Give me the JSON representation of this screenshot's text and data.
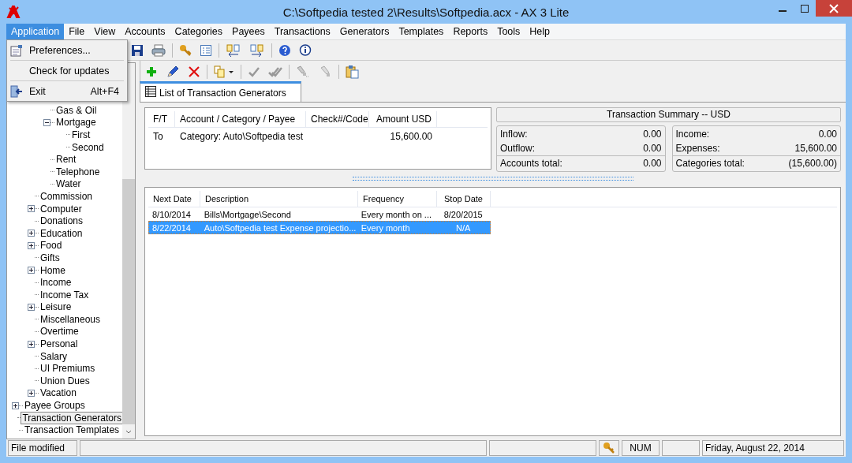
{
  "window": {
    "title": "C:\\Softpedia tested 2\\Results\\Softpedia.acx - AX 3 Lite"
  },
  "menubar": [
    {
      "label": "Application",
      "selected": true
    },
    {
      "label": "File",
      "selected": false
    },
    {
      "label": "View",
      "selected": false
    },
    {
      "label": "Accounts",
      "selected": false
    },
    {
      "label": "Categories",
      "selected": false
    },
    {
      "label": "Payees",
      "selected": false
    },
    {
      "label": "Transactions",
      "selected": false
    },
    {
      "label": "Generators",
      "selected": false
    },
    {
      "label": "Templates",
      "selected": false
    },
    {
      "label": "Reports",
      "selected": false
    },
    {
      "label": "Tools",
      "selected": false
    },
    {
      "label": "Help",
      "selected": false
    }
  ],
  "app_menu": [
    {
      "label": "Preferences...",
      "kind": "prefs"
    },
    {
      "label": "Check for updates",
      "kind": "plain"
    },
    {
      "label": "Exit",
      "kind": "exit",
      "shortcut": "Alt+F4"
    }
  ],
  "tree": [
    {
      "children": [
        {
          "children": [
            {
              "label": "Gas & Oil",
              "selected": false
            },
            {
              "label": "Mortgage",
              "expanded": true,
              "selected": false,
              "children": [
                {
                  "label": "First",
                  "selected": false
                },
                {
                  "label": "Second",
                  "selected": false
                }
              ]
            },
            {
              "label": "Rent",
              "selected": false
            },
            {
              "label": "Telephone",
              "selected": false
            },
            {
              "label": "Water",
              "selected": false
            }
          ]
        },
        {
          "label": "Commission",
          "selected": false
        },
        {
          "label": "Computer",
          "expanded": false,
          "selected": false
        },
        {
          "label": "Donations",
          "selected": false
        },
        {
          "label": "Education",
          "expanded": false,
          "selected": false
        },
        {
          "label": "Food",
          "expanded": false,
          "selected": false
        },
        {
          "label": "Gifts",
          "selected": false
        },
        {
          "label": "Home",
          "expanded": false,
          "selected": false
        },
        {
          "label": "Income",
          "selected": false
        },
        {
          "label": "Income Tax",
          "selected": false
        },
        {
          "label": "Leisure",
          "expanded": false,
          "selected": false
        },
        {
          "label": "Miscellaneous",
          "selected": false
        },
        {
          "label": "Overtime",
          "selected": false
        },
        {
          "label": "Personal",
          "expanded": false,
          "selected": false
        },
        {
          "label": "Salary",
          "selected": false
        },
        {
          "label": "UI Premiums",
          "selected": false
        },
        {
          "label": "Union Dues",
          "selected": false
        },
        {
          "label": "Vacation",
          "expanded": false,
          "selected": false
        }
      ]
    },
    {
      "label": "Payee Groups",
      "expanded": false,
      "selected": false
    },
    {
      "label": "Transaction Generators",
      "selected": true
    },
    {
      "label": "Transaction Templates",
      "selected": false
    }
  ],
  "tab": {
    "label": "List of Transaction Generators"
  },
  "splits": {
    "columns": [
      "F/T",
      "Account / Category / Payee",
      "Check#/Code",
      "Amount USD"
    ],
    "rows": [
      [
        "To",
        "Category: Auto\\Softpedia test",
        "",
        "15,600.00"
      ]
    ]
  },
  "summary": {
    "title": "Transaction Summary -- USD",
    "accounts": [
      {
        "label": "Inflow:",
        "value": "0.00"
      },
      {
        "label": "Outflow:",
        "value": "0.00"
      },
      {
        "label": "Accounts total:",
        "value": "0.00"
      }
    ],
    "categories": [
      {
        "label": "Income:",
        "value": "0.00"
      },
      {
        "label": "Expenses:",
        "value": "15,600.00"
      },
      {
        "label": "Categories total:",
        "value": "(15,600.00)"
      }
    ]
  },
  "generators": {
    "columns": [
      "Next Date",
      "Description",
      "Frequency",
      "Stop Date"
    ],
    "rows": [
      {
        "cells": [
          "8/10/2014",
          "Bills\\Mortgage\\Second",
          "Every month on ...",
          "8/20/2015"
        ],
        "selected": false
      },
      {
        "cells": [
          "8/22/2014",
          "Auto\\Softpedia test Expense projectio...",
          "Every month",
          "N/A"
        ],
        "selected": true
      }
    ]
  },
  "status_bar": {
    "message": "File modified",
    "num": "NUM",
    "date": "Friday, August 22, 2014"
  }
}
